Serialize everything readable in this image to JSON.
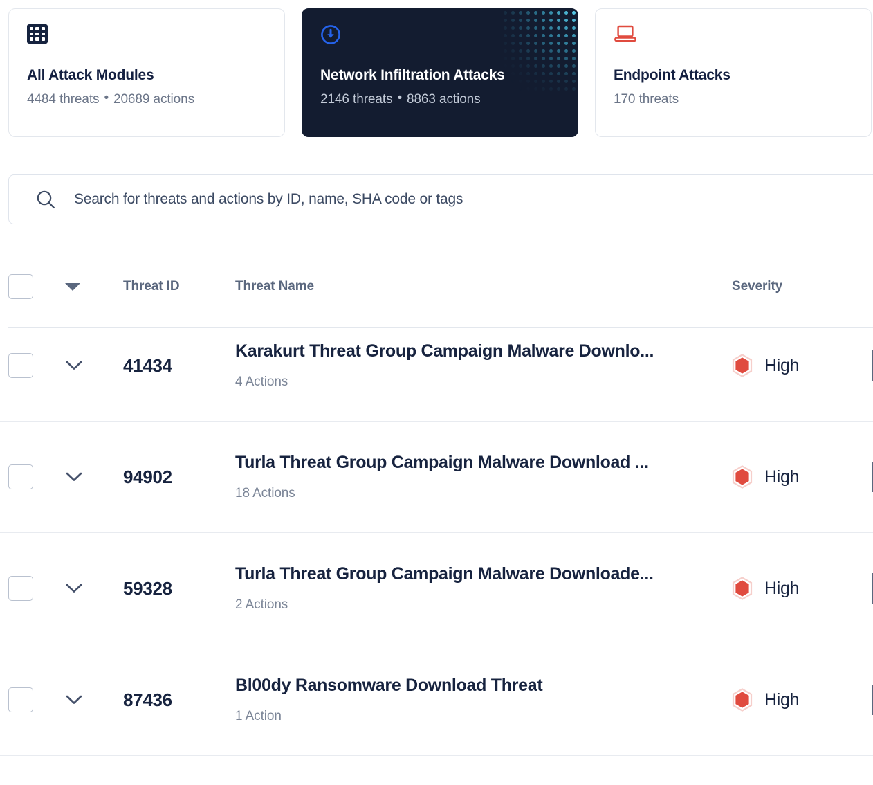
{
  "colors": {
    "accent_blue": "#2563eb",
    "danger_red": "#e04b3f",
    "dark_navy": "#131c30",
    "text_navy": "#17233f",
    "muted": "#6b7588",
    "border": "#e3e7ed",
    "halftone_cyan": "#3fb6d8"
  },
  "cards": [
    {
      "icon": "grid-icon",
      "title": "All Attack Modules",
      "threats": "4484 threats",
      "separator": "•",
      "actions": "20689 actions",
      "active": false
    },
    {
      "icon": "download-circle-icon",
      "title": "Network Infiltration Attacks",
      "threats": "2146 threats",
      "separator": "•",
      "actions": "8863 actions",
      "active": true
    },
    {
      "icon": "laptop-icon",
      "title": "Endpoint Attacks",
      "threats": "170 threats",
      "separator": "",
      "actions": "",
      "active": false
    }
  ],
  "search": {
    "placeholder": "Search for threats and actions by ID, name, SHA code or tags",
    "value": "",
    "icon": "search-icon"
  },
  "table": {
    "headers": {
      "threat_id": "Threat ID",
      "threat_name": "Threat Name",
      "severity": "Severity"
    },
    "rows": [
      {
        "id": "41434",
        "name": "Karakurt Threat Group Campaign Malware Downlo...",
        "actions": "4 Actions",
        "severity": "High"
      },
      {
        "id": "94902",
        "name": "Turla Threat Group Campaign Malware Download ...",
        "actions": "18 Actions",
        "severity": "High"
      },
      {
        "id": "59328",
        "name": "Turla Threat Group Campaign Malware Downloade...",
        "actions": "2 Actions",
        "severity": "High"
      },
      {
        "id": "87436",
        "name": "Bl00dy Ransomware Download Threat",
        "actions": "1 Action",
        "severity": "High"
      }
    ]
  }
}
